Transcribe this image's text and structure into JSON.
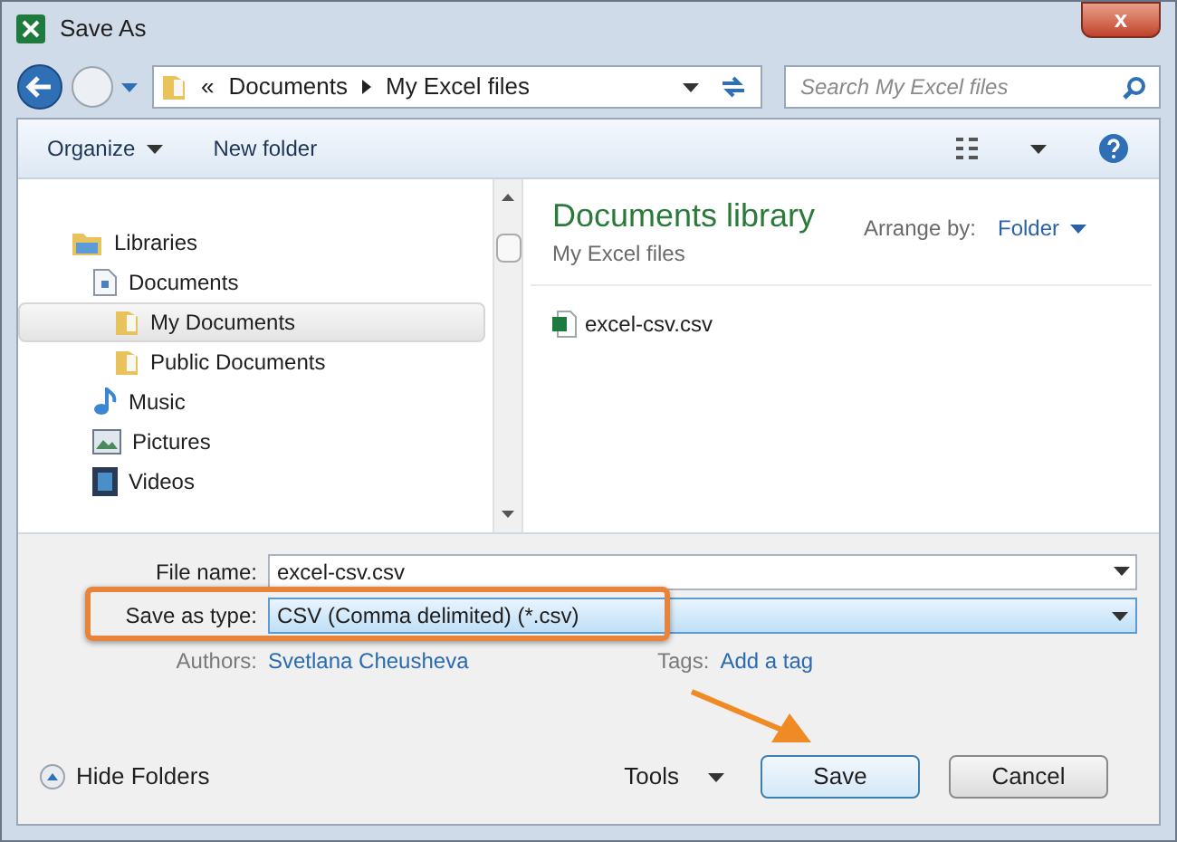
{
  "window": {
    "title": "Save As",
    "close": "x"
  },
  "address": {
    "crumbs": [
      "«",
      "Documents",
      "My Excel files"
    ],
    "search_placeholder": "Search My Excel files"
  },
  "toolbar": {
    "organize": "Organize",
    "new_folder": "New folder"
  },
  "nav_tree": [
    {
      "label": "Libraries",
      "kind": "library",
      "selected": false,
      "children": [
        {
          "label": "Documents",
          "kind": "document",
          "selected": false,
          "children": [
            {
              "label": "My Documents",
              "kind": "folder",
              "selected": true
            },
            {
              "label": "Public Documents",
              "kind": "folder",
              "selected": false
            }
          ]
        },
        {
          "label": "Music",
          "kind": "music",
          "selected": false
        },
        {
          "label": "Pictures",
          "kind": "picture",
          "selected": false
        },
        {
          "label": "Videos",
          "kind": "video",
          "selected": false
        }
      ]
    }
  ],
  "content": {
    "title": "Documents library",
    "subtitle": "My Excel files",
    "arrange_label": "Arrange by:",
    "arrange_value": "Folder",
    "files": [
      {
        "name": "excel-csv.csv"
      }
    ]
  },
  "form": {
    "file_name_label": "File name:",
    "file_name": "excel-csv.csv",
    "type_label": "Save as type:",
    "type_value": "CSV (Comma delimited) (*.csv)",
    "authors_label": "Authors:",
    "authors": "Svetlana Cheusheva",
    "tags_label": "Tags:",
    "tags": "Add a tag"
  },
  "footer": {
    "hide_folders": "Hide Folders",
    "tools": "Tools",
    "save": "Save",
    "cancel": "Cancel"
  }
}
